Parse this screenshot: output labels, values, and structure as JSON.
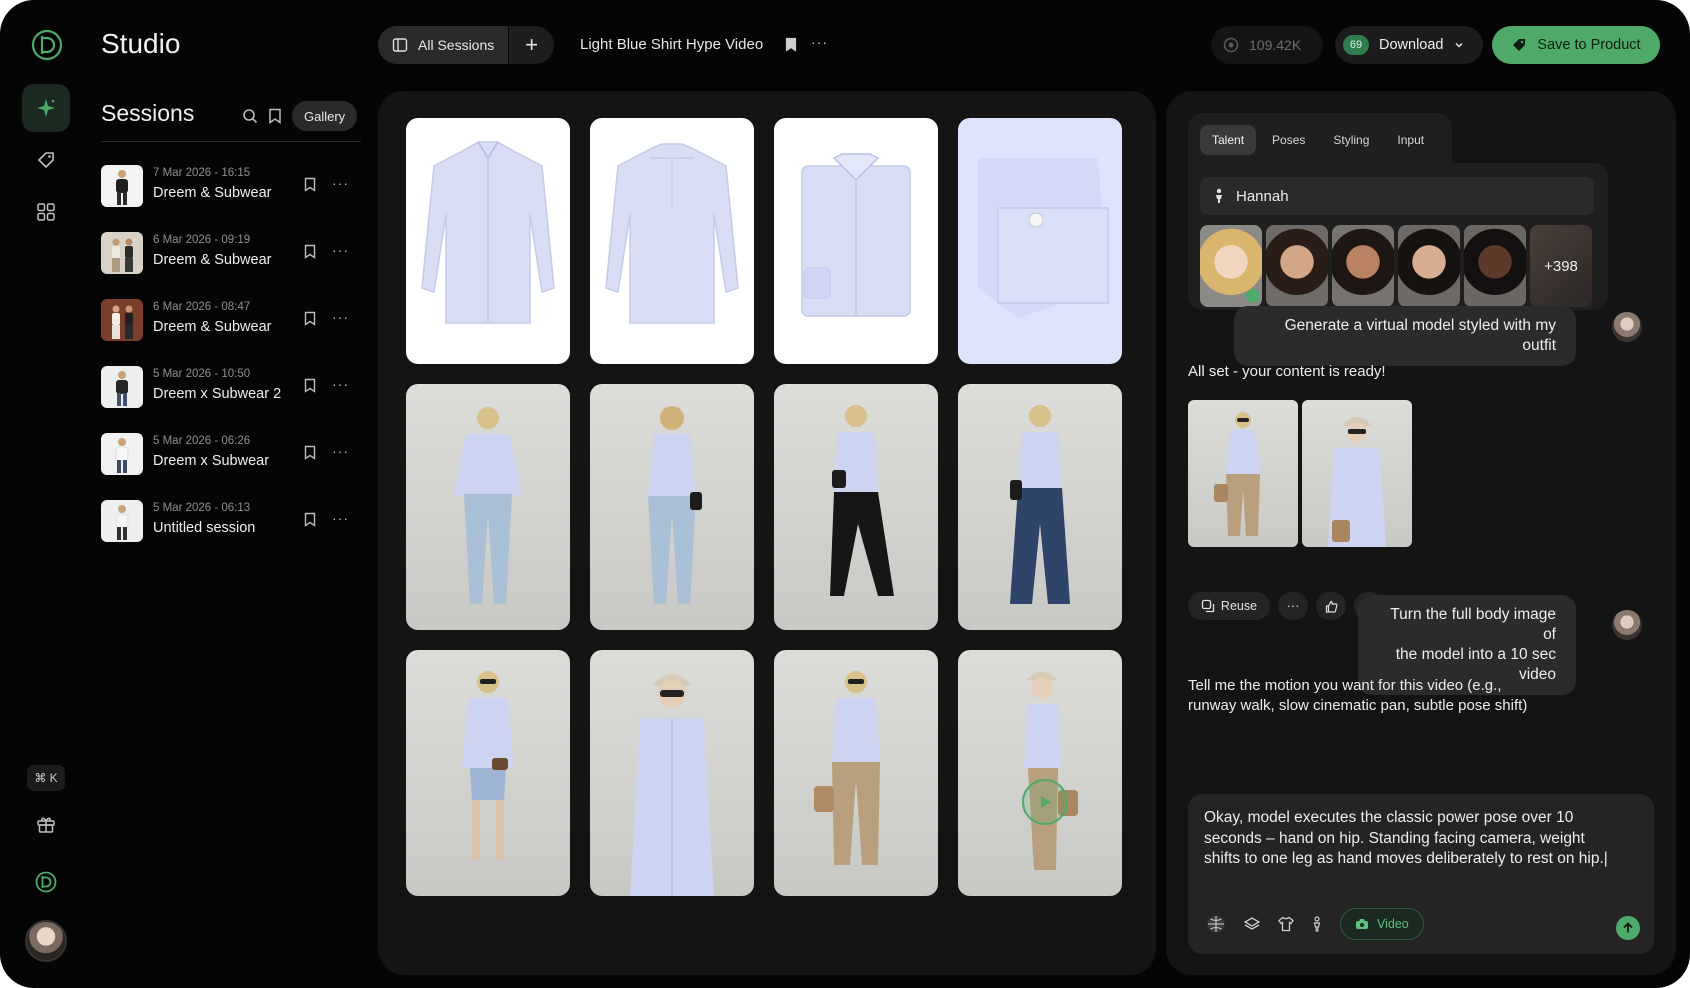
{
  "app": {
    "title": "Studio"
  },
  "rail": {
    "items": [
      {
        "icon": "sparkle-icon",
        "active": true
      },
      {
        "icon": "tag-icon",
        "active": false
      },
      {
        "icon": "grid-icon",
        "active": false
      }
    ],
    "shortcut": "⌘ K"
  },
  "sessions": {
    "title": "Sessions",
    "gallery_label": "Gallery",
    "items": [
      {
        "date": "7 Mar 2026 - 16:15",
        "name": "Dreem & Subwear"
      },
      {
        "date": "6 Mar 2026 - 09:19",
        "name": "Dreem & Subwear"
      },
      {
        "date": "6 Mar 2026 - 08:47",
        "name": "Dreem & Subwear"
      },
      {
        "date": "5 Mar 2026 - 10:50",
        "name": "Dreem x Subwear 2"
      },
      {
        "date": "5 Mar 2026 - 06:26",
        "name": "Dreem x Subwear"
      },
      {
        "date": "5 Mar 2026 - 06:13",
        "name": "Untitled session"
      }
    ],
    "more_label": "···"
  },
  "topbar": {
    "all_sessions_label": "All Sessions",
    "add_label": "+",
    "project_title": "Light Blue Shirt Hype Video",
    "more_label": "···",
    "credits": "109.42K",
    "download_badge": "69",
    "download_label": "Download",
    "save_label": "Save to Product"
  },
  "chat": {
    "tabs": [
      "Talent",
      "Poses",
      "Styling",
      "Input"
    ],
    "talent_name": "Hannah",
    "faces_more": "+398",
    "user_msg_1": "Generate a virtual model styled with my outfit",
    "ai_msg_1": "All set - your content is ready!",
    "reuse_label": "Reuse",
    "more_label": "···",
    "user_msg_2_line1": "Turn the full body image of",
    "user_msg_2_line2": "the model into a 10 sec video",
    "ai_msg_2_line1": "Tell me the motion you want for this video (e.g.,",
    "ai_msg_2_line2": "runway walk, slow cinematic pan, subtle pose shift)",
    "composer_text": "Okay, model executes the classic power pose over 10 seconds – hand on hip. Standing facing camera, weight shifts to one leg as hand moves deliberately to rest on hip.|",
    "video_chip": "Video"
  },
  "colors": {
    "accent": "#4faa6a",
    "background": "#050505",
    "panel": "#141414",
    "shirt": "#d9def5"
  }
}
